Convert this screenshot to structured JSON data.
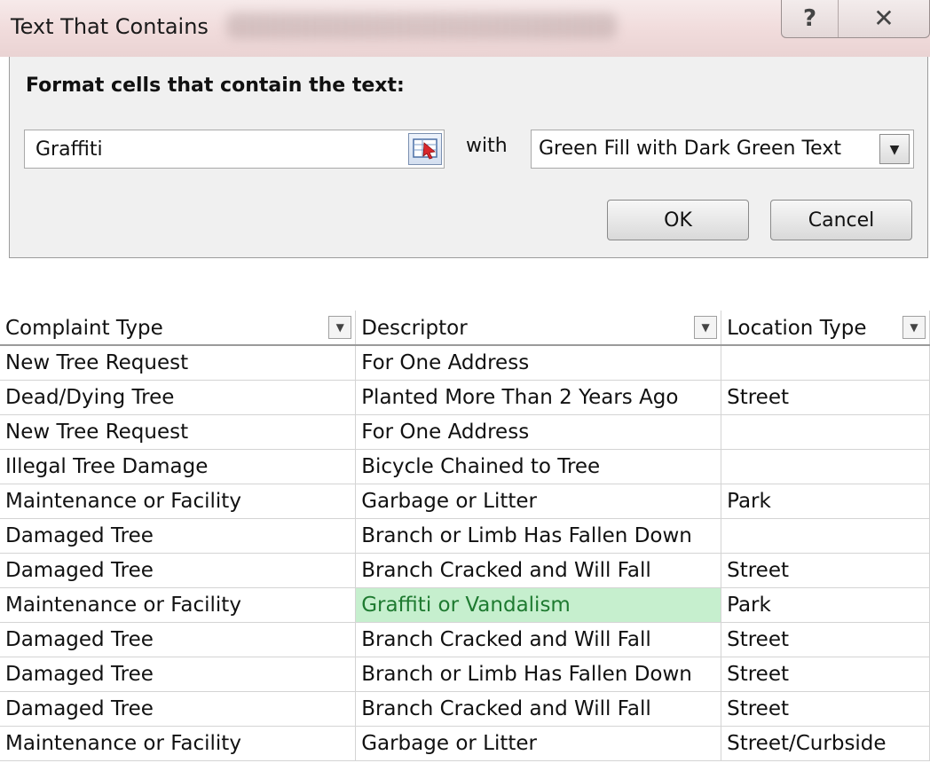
{
  "dialog": {
    "title": "Text That Contains",
    "help_glyph": "?",
    "close_glyph": "✕",
    "prompt": "Format cells that contain the text:",
    "text_value": "Graffiti",
    "with_label": "with",
    "format_value": "Green Fill with Dark Green Text",
    "ok_label": "OK",
    "cancel_label": "Cancel"
  },
  "sheet": {
    "headers": [
      "Complaint Type",
      "Descriptor",
      "Location Type"
    ],
    "highlight_colors": {
      "fill": "#c6efce",
      "text": "#1e7a30"
    },
    "rows": [
      [
        "New Tree Request",
        "For One Address",
        ""
      ],
      [
        "Dead/Dying Tree",
        "Planted More Than 2 Years Ago",
        "Street"
      ],
      [
        "New Tree Request",
        "For One Address",
        ""
      ],
      [
        "Illegal Tree Damage",
        "Bicycle Chained to Tree",
        ""
      ],
      [
        "Maintenance or Facility",
        "Garbage or Litter",
        "Park"
      ],
      [
        "Damaged Tree",
        "Branch or Limb Has Fallen Down",
        ""
      ],
      [
        "Damaged Tree",
        "Branch Cracked and Will Fall",
        "Street"
      ],
      [
        "Maintenance or Facility",
        "Graffiti or Vandalism",
        "Park"
      ],
      [
        "Damaged Tree",
        "Branch Cracked and Will Fall",
        "Street"
      ],
      [
        "Damaged Tree",
        "Branch or Limb Has Fallen Down",
        "Street"
      ],
      [
        "Damaged Tree",
        "Branch Cracked and Will Fall",
        "Street"
      ],
      [
        "Maintenance or Facility",
        "Garbage or Litter",
        "Street/Curbside"
      ]
    ]
  }
}
